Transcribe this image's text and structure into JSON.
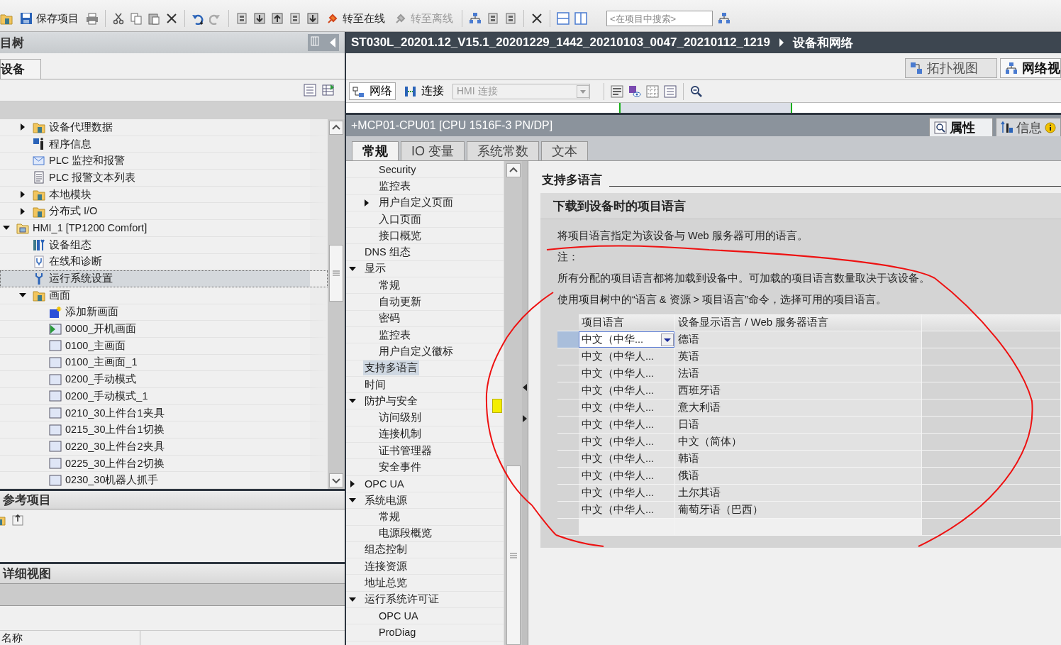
{
  "toolbar": {
    "save": {
      "label": "保存项目"
    },
    "go_online": {
      "label": "转至在线",
      "disabled": false
    },
    "go_offline": {
      "label": "转至离线",
      "disabled": true
    },
    "search": {
      "placeholder": "<在项目中搜索>"
    }
  },
  "project_tree": {
    "title": "目树",
    "tab": {
      "label": "设备",
      "selected": true
    },
    "cut_group": [
      {
        "label": "设备代理数据",
        "kind": "folder",
        "expanded": false,
        "selected": false
      },
      {
        "label": "程序信息",
        "kind": "info",
        "selected": false
      },
      {
        "label": "PLC 监控和报警",
        "kind": "alarm",
        "selected": false
      },
      {
        "label": "PLC 报警文本列表",
        "kind": "textlist",
        "selected": false
      },
      {
        "label": "本地模块",
        "kind": "folder",
        "expanded": false,
        "selected": false
      },
      {
        "label": "分布式 I/O",
        "kind": "folder",
        "expanded": false,
        "selected": false
      }
    ],
    "items": [
      {
        "label": "HMI_1 [TP1200 Comfort]",
        "kind": "device",
        "expanded": true,
        "selected": false,
        "children": [
          {
            "label": "设备组态",
            "kind": "config",
            "selected": false
          },
          {
            "label": "在线和诊断",
            "kind": "diagnostics",
            "selected": false
          },
          {
            "label": "运行系统设置",
            "kind": "wrench",
            "selected": true
          },
          {
            "label": "画面",
            "kind": "folder",
            "expanded": true,
            "selected": false,
            "children": [
              {
                "label": "添加新画面",
                "kind": "add-screen",
                "selected": false
              },
              {
                "label": "0000_开机画面",
                "kind": "start-screen",
                "selected": false
              },
              {
                "label": "0100_主画面",
                "kind": "screen",
                "selected": false
              },
              {
                "label": "0100_主画面_1",
                "kind": "screen",
                "selected": false
              },
              {
                "label": "0200_手动模式",
                "kind": "screen",
                "selected": false
              },
              {
                "label": "0200_手动模式_1",
                "kind": "screen",
                "selected": false
              },
              {
                "label": "0210_30上件台1夹具",
                "kind": "screen",
                "selected": false
              },
              {
                "label": "0215_30上件台1切换",
                "kind": "screen",
                "selected": false
              },
              {
                "label": "0220_30上件台2夹具",
                "kind": "screen",
                "selected": false
              },
              {
                "label": "0225_30上件台2切换",
                "kind": "screen",
                "selected": false
              },
              {
                "label": "0230_30机器人抓手",
                "kind": "screen",
                "selected": false
              }
            ]
          }
        ]
      }
    ]
  },
  "reference_projects": {
    "title": "参考项目"
  },
  "details_view": {
    "title": "详细视图",
    "columns": [
      "名称"
    ]
  },
  "editor": {
    "breadcrumb": [
      "ST030L_20201.12_V15.1_20201229_1442_20210103_0047_20210112_1219",
      "设备和网络"
    ],
    "view_tabs": [
      {
        "label": "拓扑视图",
        "selected": false
      },
      {
        "label": "网络视",
        "selected": true
      }
    ],
    "mode_buttons": [
      {
        "label": "网络",
        "selected": true
      },
      {
        "label": "连接",
        "selected": false
      }
    ],
    "connection_type": {
      "value": "HMI 连接",
      "disabled": true
    }
  },
  "inspector": {
    "title": "+MCP01-CPU01 [CPU 1516F-3 PN/DP]",
    "side_tabs": [
      {
        "label": "属性",
        "selected": true
      },
      {
        "label": "信息",
        "selected": false
      }
    ],
    "tabs": [
      {
        "label": "常规",
        "selected": true
      },
      {
        "label": "IO 变量",
        "selected": false
      },
      {
        "label": "系统常数",
        "selected": false
      },
      {
        "label": "文本",
        "selected": false
      }
    ],
    "nav": {
      "cut_group": [
        {
          "label": "Security",
          "selected": false
        },
        {
          "label": "监控表",
          "selected": false
        },
        {
          "label": "用户自定义页面",
          "expanded": false,
          "selected": false
        },
        {
          "label": "入口页面",
          "selected": false
        },
        {
          "label": "接口概览",
          "selected": false
        }
      ],
      "items": [
        {
          "label": "DNS 组态",
          "selected": false
        },
        {
          "label": "显示",
          "expanded": true,
          "selected": false,
          "children": [
            {
              "label": "常规",
              "selected": false
            },
            {
              "label": "自动更新",
              "selected": false
            },
            {
              "label": "密码",
              "selected": false
            },
            {
              "label": "监控表",
              "selected": false
            },
            {
              "label": "用户自定义徽标",
              "selected": false
            }
          ]
        },
        {
          "label": "支持多语言",
          "selected": true
        },
        {
          "label": "时间",
          "selected": false
        },
        {
          "label": "防护与安全",
          "expanded": true,
          "selected": false,
          "children": [
            {
              "label": "访问级别",
              "selected": false
            },
            {
              "label": "连接机制",
              "selected": false
            },
            {
              "label": "证书管理器",
              "selected": false
            },
            {
              "label": "安全事件",
              "selected": false
            }
          ]
        },
        {
          "label": "OPC UA",
          "expanded": false,
          "selected": false
        },
        {
          "label": "系统电源",
          "expanded": true,
          "selected": false,
          "children": [
            {
              "label": "常规",
              "selected": false
            },
            {
              "label": "电源段概览",
              "selected": false
            }
          ]
        },
        {
          "label": "组态控制",
          "selected": false
        },
        {
          "label": "连接资源",
          "selected": false
        },
        {
          "label": "地址总览",
          "selected": false
        },
        {
          "label": "运行系统许可证",
          "expanded": true,
          "selected": false,
          "children": [
            {
              "label": "OPC UA",
              "selected": false
            },
            {
              "label": "ProDiag",
              "selected": false
            }
          ]
        }
      ]
    },
    "section": {
      "title": "支持多语言",
      "group": {
        "title": "下载到设备时的项目语言",
        "paragraphs": [
          "将项目语言指定为该设备与 Web 服务器可用的语言。",
          "注：",
          "所有分配的项目语言都将加载到设备中。可加载的项目语言数量取决于该设备。",
          "使用项目树中的“语言 & 资源 > 项目语言”命令，选择可用的项目语言。"
        ],
        "table": {
          "columns": [
            "项目语言",
            "设备显示语言 / Web 服务器语言"
          ],
          "rows": [
            {
              "project_language": "中文（中华...",
              "device_language": "德语",
              "selected": true
            },
            {
              "project_language": "中文（中华人...",
              "device_language": "英语",
              "selected": false
            },
            {
              "project_language": "中文（中华人...",
              "device_language": "法语",
              "selected": false
            },
            {
              "project_language": "中文（中华人...",
              "device_language": "西班牙语",
              "selected": false
            },
            {
              "project_language": "中文（中华人...",
              "device_language": "意大利语",
              "selected": false
            },
            {
              "project_language": "中文（中华人...",
              "device_language": "日语",
              "selected": false
            },
            {
              "project_language": "中文（中华人...",
              "device_language": "中文（简体）",
              "selected": false
            },
            {
              "project_language": "中文（中华人...",
              "device_language": "韩语",
              "selected": false
            },
            {
              "project_language": "中文（中华人...",
              "device_language": "俄语",
              "selected": false
            },
            {
              "project_language": "中文（中华人...",
              "device_language": "土尔其语",
              "selected": false
            },
            {
              "project_language": "中文（中华人...",
              "device_language": "葡萄牙语（巴西）",
              "selected": false
            }
          ]
        }
      }
    }
  }
}
